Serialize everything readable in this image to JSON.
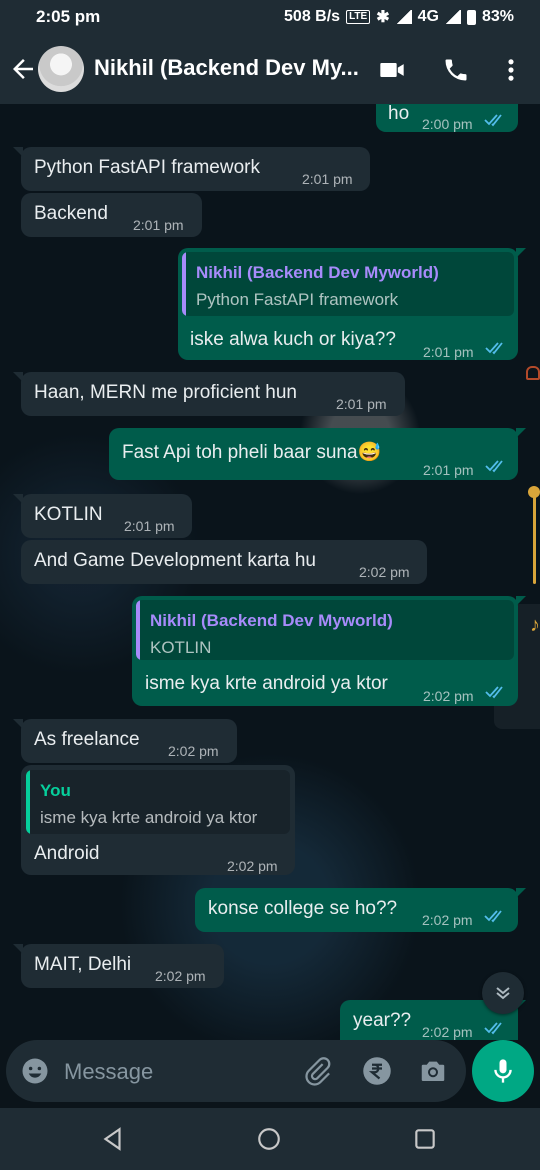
{
  "status": {
    "time": "2:05 pm",
    "speed": "508 B/s",
    "network": "4G",
    "battery": "83%"
  },
  "header": {
    "contact_name": "Nikhil (Backend Dev My..."
  },
  "messages": [
    {
      "text": "ho",
      "time": "2:00 pm"
    },
    {
      "text": "Python FastAPI framework",
      "time": "2:01 pm"
    },
    {
      "text": "Backend",
      "time": "2:01 pm"
    },
    {
      "quote_name": "Nikhil (Backend Dev Myworld)",
      "quote_text": "Python FastAPI framework",
      "text": "iske alwa kuch or kiya??",
      "time": "2:01 pm"
    },
    {
      "text": "Haan, MERN me proficient hun",
      "time": "2:01 pm"
    },
    {
      "text": "Fast Api toh pheli baar suna😅",
      "time": "2:01 pm"
    },
    {
      "text": "KOTLIN",
      "time": "2:01 pm"
    },
    {
      "text": "And Game Development karta hu",
      "time": "2:02 pm"
    },
    {
      "quote_name": "Nikhil (Backend Dev Myworld)",
      "quote_text": "KOTLIN",
      "text": "isme kya krte android ya ktor",
      "time": "2:02 pm"
    },
    {
      "text": "As freelance",
      "time": "2:02 pm"
    },
    {
      "quote_name": "You",
      "quote_text": "isme kya krte android ya ktor",
      "text": "Android",
      "time": "2:02 pm"
    },
    {
      "text": "konse college se ho??",
      "time": "2:02 pm"
    },
    {
      "text": "MAIT, Delhi",
      "time": "2:02 pm"
    },
    {
      "text": "year??",
      "time": "2:02 pm"
    }
  ],
  "composer": {
    "placeholder": "Message"
  },
  "colors": {
    "incoming_bubble": "#1f2c34",
    "outgoing_bubble": "#005c4b",
    "accent": "#00a884",
    "read_ticks": "#53bdeb",
    "quote_purple": "#a78bfa",
    "quote_green": "#06cf9c"
  },
  "icons": [
    "back-arrow-icon",
    "video-call-icon",
    "phone-icon",
    "more-options-icon",
    "emoji-icon",
    "attach-icon",
    "rupee-icon",
    "camera-icon",
    "mic-icon",
    "chevron-down-icon",
    "nav-back-icon",
    "nav-home-icon",
    "nav-recents-icon"
  ]
}
